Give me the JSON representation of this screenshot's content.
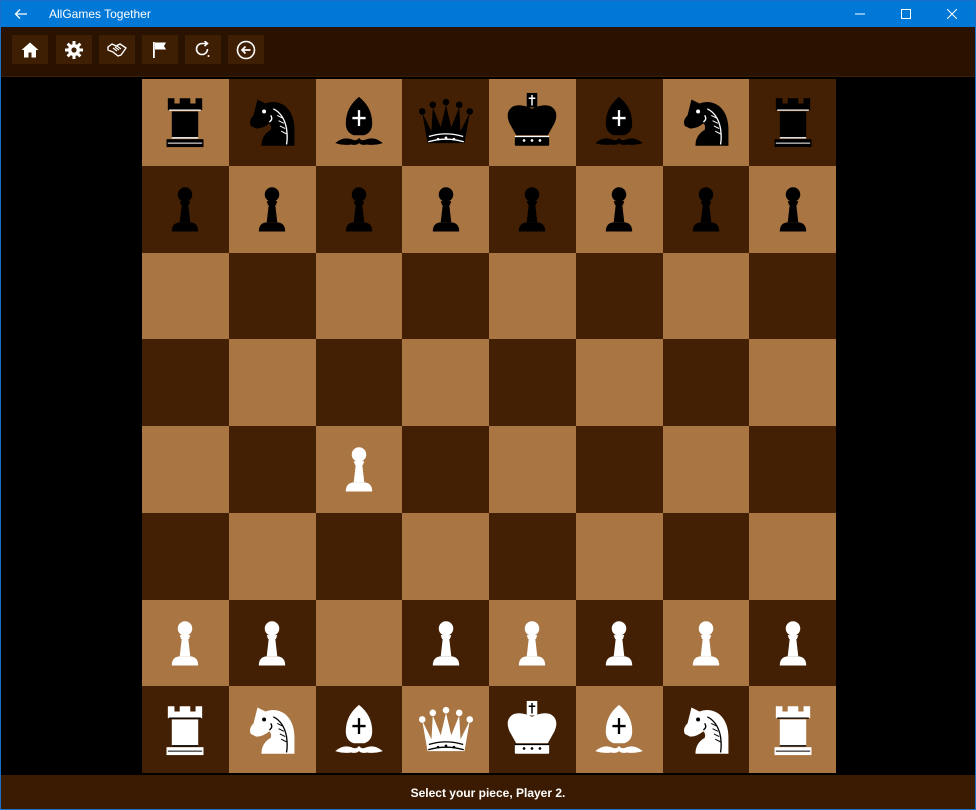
{
  "window": {
    "title": "AllGames Together",
    "back_icon": "back-arrow-icon",
    "controls": [
      "minimize-icon",
      "maximize-icon",
      "close-icon"
    ]
  },
  "toolbar": {
    "buttons": [
      {
        "name": "home-button",
        "icon": "home-icon"
      },
      {
        "name": "settings-button",
        "icon": "gear-icon"
      },
      {
        "name": "offer-draw-button",
        "icon": "handshake-icon"
      },
      {
        "name": "resign-button",
        "icon": "flag-icon"
      },
      {
        "name": "redo-button",
        "icon": "redo-icon"
      },
      {
        "name": "back-button",
        "icon": "circle-arrow-left-icon"
      }
    ]
  },
  "board": {
    "light_color": "#a87543",
    "dark_color": "#432003",
    "rows": [
      [
        "bR",
        "bN",
        "bB",
        "bQ",
        "bK",
        "bB",
        "bN",
        "bR"
      ],
      [
        "bP",
        "bP",
        "bP",
        "bP",
        "bP",
        "bP",
        "bP",
        "bP"
      ],
      [
        "",
        "",
        "",
        "",
        "",
        "",
        "",
        ""
      ],
      [
        "",
        "",
        "",
        "",
        "",
        "",
        "",
        ""
      ],
      [
        "",
        "",
        "wP",
        "",
        "",
        "",
        "",
        ""
      ],
      [
        "",
        "",
        "",
        "",
        "",
        "",
        "",
        ""
      ],
      [
        "wP",
        "wP",
        "",
        "wP",
        "wP",
        "wP",
        "wP",
        "wP"
      ],
      [
        "wR",
        "wN",
        "wB",
        "wQ",
        "wK",
        "wB",
        "wN",
        "wR"
      ]
    ]
  },
  "status": {
    "message": "Select your piece, Player 2."
  }
}
